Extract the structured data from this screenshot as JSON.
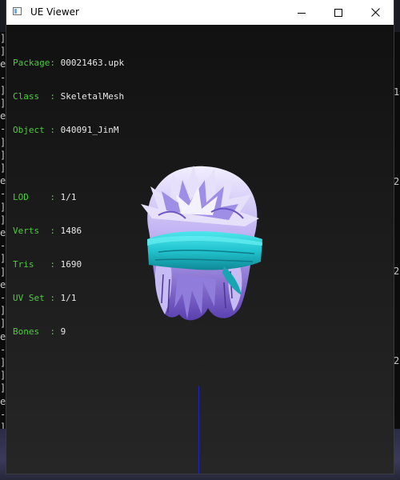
{
  "window": {
    "title": "UE Viewer"
  },
  "info": {
    "package_key": "Package:",
    "package_value": "00021463.upk",
    "class_key": "Class  :",
    "class_value": "SkeletalMesh",
    "object_key": "Object :",
    "object_value": "040091_JinM",
    "lod_key": "LOD    :",
    "lod_value": "1/1",
    "verts_key": "Verts  :",
    "verts_value": "1486",
    "tris_key": "Tris   :",
    "tris_value": "1690",
    "uvset_key": "UV Set :",
    "uvset_value": "1/1",
    "bones_key": "Bones  :",
    "bones_value": "9"
  },
  "colors": {
    "label_green": "#4ccc3c",
    "value_white": "#e8e8e8",
    "bandana_cyan": "#21c4cf",
    "hair_lavender": "#b9a8f0",
    "axis_blue": "#1d22c8"
  },
  "icons": {
    "app": "window-icon",
    "minimize": "minimize-icon",
    "maximize": "maximize-icon",
    "close": "close-icon"
  }
}
